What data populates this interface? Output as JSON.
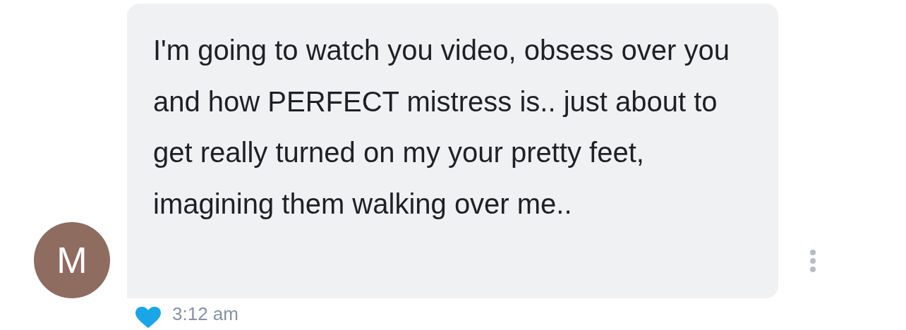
{
  "message": {
    "avatar_initial": "M",
    "text": "I'm going to watch you video, obsess over you and how PERFECT mistress is.. just about to get really turned on my your pretty feet, imagining them walking over me..",
    "liked": true,
    "time": "3:12 am"
  }
}
